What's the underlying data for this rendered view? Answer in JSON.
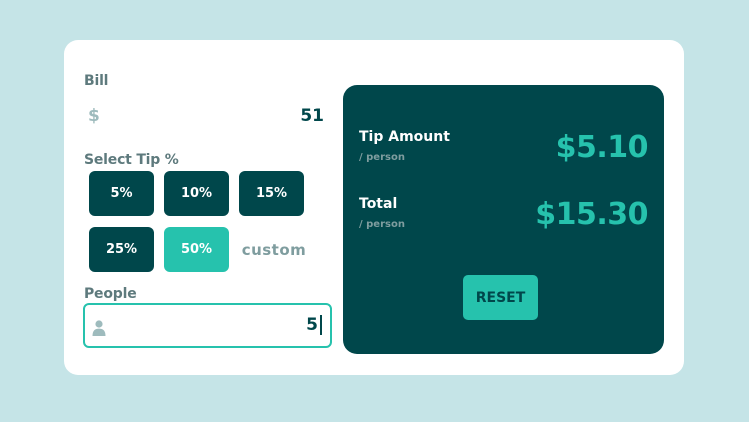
{
  "bill": {
    "label": "Bill",
    "currency_icon": "dollar-icon",
    "currency_symbol": "$",
    "value": "51"
  },
  "tip": {
    "label": "Select Tip %",
    "options": [
      "5%",
      "10%",
      "15%",
      "25%",
      "50%"
    ],
    "selected": "50%",
    "custom_placeholder": "custom"
  },
  "people": {
    "label": "People",
    "icon": "person-icon",
    "value": "5"
  },
  "results": {
    "tip_amount": {
      "title": "Tip Amount",
      "subtitle": "/ person",
      "value": "$5.10"
    },
    "total": {
      "title": "Total",
      "subtitle": "/ person",
      "value": "$15.30"
    },
    "reset_label": "RESET"
  },
  "colors": {
    "background": "#c5e4e7",
    "card": "#ffffff",
    "dark_cyan": "#00474b",
    "strong_cyan": "#26c2ad",
    "grayish_cyan": "#5e7a7d"
  }
}
